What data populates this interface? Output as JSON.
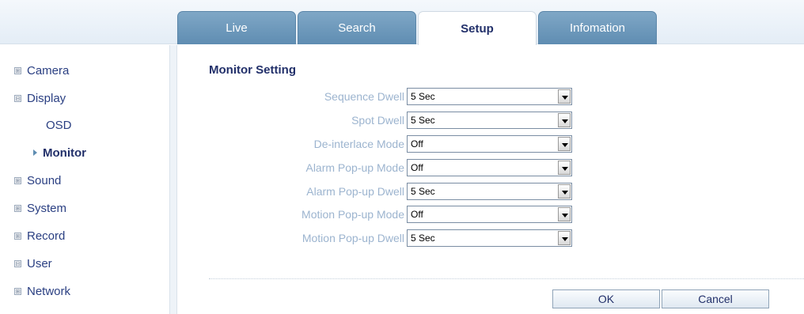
{
  "tabs": [
    {
      "label": "Live",
      "active": false
    },
    {
      "label": "Search",
      "active": false
    },
    {
      "label": "Setup",
      "active": true
    },
    {
      "label": "Infomation",
      "active": false
    }
  ],
  "sidebar": {
    "items": [
      {
        "label": "Camera",
        "expander": "⊞"
      },
      {
        "label": "Display",
        "expander": "⊟"
      },
      {
        "label": "OSD"
      },
      {
        "label": "Monitor",
        "active": true
      },
      {
        "label": "Sound",
        "expander": "⊞"
      },
      {
        "label": "System",
        "expander": "⊞"
      },
      {
        "label": "Record",
        "expander": "⊞"
      },
      {
        "label": "User",
        "expander": "⊟"
      },
      {
        "label": "Network",
        "expander": "⊞"
      }
    ]
  },
  "main": {
    "title": "Monitor Setting",
    "fields": [
      {
        "label": "Sequence Dwell",
        "value": "5 Sec"
      },
      {
        "label": "Spot Dwell",
        "value": "5 Sec"
      },
      {
        "label": "De-interlace Mode",
        "value": "Off"
      },
      {
        "label": "Alarm Pop-up Mode",
        "value": "Off"
      },
      {
        "label": "Alarm Pop-up Dwell",
        "value": "5 Sec"
      },
      {
        "label": "Motion Pop-up Mode",
        "value": "Off"
      },
      {
        "label": "Motion Pop-up Dwell",
        "value": "5 Sec"
      }
    ],
    "ok_label": "OK",
    "cancel_label": "Cancel"
  },
  "colors": {
    "tab_active_text": "#22306a",
    "tab_inactive_bg": "#6f99bc",
    "label_text": "#9cb4cf",
    "nav_text": "#2a3f82"
  }
}
